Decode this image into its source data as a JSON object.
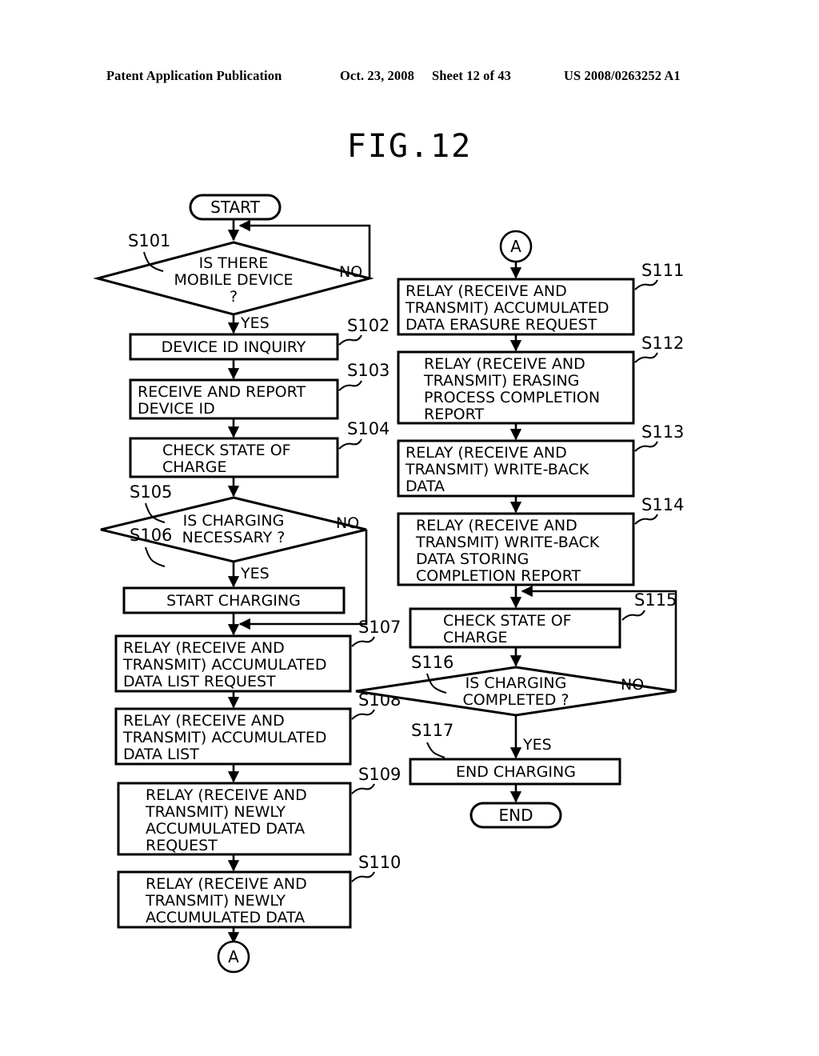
{
  "header": {
    "left": "Patent Application Publication",
    "date": "Oct. 23, 2008",
    "sheet": "Sheet 12 of 43",
    "number": "US 2008/0263252 A1"
  },
  "figure": {
    "title": "FIG.12"
  },
  "flowchart": {
    "terminals": {
      "start": "START",
      "end": "END"
    },
    "connectors": {
      "a_bottom_left": "A",
      "a_top_right": "A"
    },
    "branch_labels": {
      "s101_no": "NO",
      "s101_yes": "YES",
      "s105_no": "NO",
      "s105_yes": "YES",
      "s116_no": "NO",
      "s116_yes": "YES"
    },
    "left_column": [
      {
        "ref": "S101",
        "shape": "decision",
        "lines": [
          "IS THERE",
          "MOBILE DEVICE",
          "?"
        ]
      },
      {
        "ref": "S102",
        "shape": "process",
        "align": "center",
        "lines": [
          "DEVICE ID INQUIRY"
        ]
      },
      {
        "ref": "S103",
        "shape": "process",
        "align": "left",
        "lines": [
          "RECEIVE AND REPORT",
          "DEVICE ID"
        ]
      },
      {
        "ref": "S104",
        "shape": "process",
        "align": "indent",
        "lines": [
          "CHECK STATE OF",
          "CHARGE"
        ]
      },
      {
        "ref": "S105",
        "shape": "decision",
        "lines": [
          "IS CHARGING",
          "NECESSARY ?"
        ]
      },
      {
        "ref": "S106",
        "shape": "process",
        "align": "center",
        "lines": [
          "START CHARGING"
        ]
      },
      {
        "ref": "S107",
        "shape": "process",
        "align": "left",
        "lines": [
          "RELAY (RECEIVE AND",
          "TRANSMIT) ACCUMULATED",
          "DATA LIST REQUEST"
        ]
      },
      {
        "ref": "S108",
        "shape": "process",
        "align": "left",
        "lines": [
          "RELAY (RECEIVE AND",
          "TRANSMIT) ACCUMULATED",
          "DATA LIST"
        ]
      },
      {
        "ref": "S109",
        "shape": "process",
        "align": "indent",
        "lines": [
          "RELAY (RECEIVE AND",
          "TRANSMIT) NEWLY",
          "ACCUMULATED DATA",
          "REQUEST"
        ]
      },
      {
        "ref": "S110",
        "shape": "process",
        "align": "indent",
        "lines": [
          "RELAY (RECEIVE AND",
          "TRANSMIT) NEWLY",
          "ACCUMULATED DATA"
        ]
      }
    ],
    "right_column": [
      {
        "ref": "S111",
        "shape": "process",
        "align": "left",
        "lines": [
          "RELAY (RECEIVE AND",
          "TRANSMIT) ACCUMULATED",
          "DATA ERASURE REQUEST"
        ]
      },
      {
        "ref": "S112",
        "shape": "process",
        "align": "indent",
        "lines": [
          "RELAY (RECEIVE AND",
          "TRANSMIT) ERASING",
          "PROCESS COMPLETION",
          "REPORT"
        ]
      },
      {
        "ref": "S113",
        "shape": "process",
        "align": "left",
        "lines": [
          "RELAY (RECEIVE AND",
          "TRANSMIT) WRITE-BACK",
          "DATA"
        ]
      },
      {
        "ref": "S114",
        "shape": "process",
        "align": "indent",
        "lines": [
          "RELAY (RECEIVE AND",
          "TRANSMIT) WRITE-BACK",
          "DATA STORING",
          "COMPLETION REPORT"
        ]
      },
      {
        "ref": "S115",
        "shape": "process",
        "align": "indent",
        "lines": [
          "CHECK STATE OF",
          "CHARGE"
        ]
      },
      {
        "ref": "S116",
        "shape": "decision",
        "lines": [
          "IS CHARGING",
          "COMPLETED ?"
        ]
      },
      {
        "ref": "S117",
        "shape": "process",
        "align": "center",
        "lines": [
          "END CHARGING"
        ]
      }
    ]
  }
}
